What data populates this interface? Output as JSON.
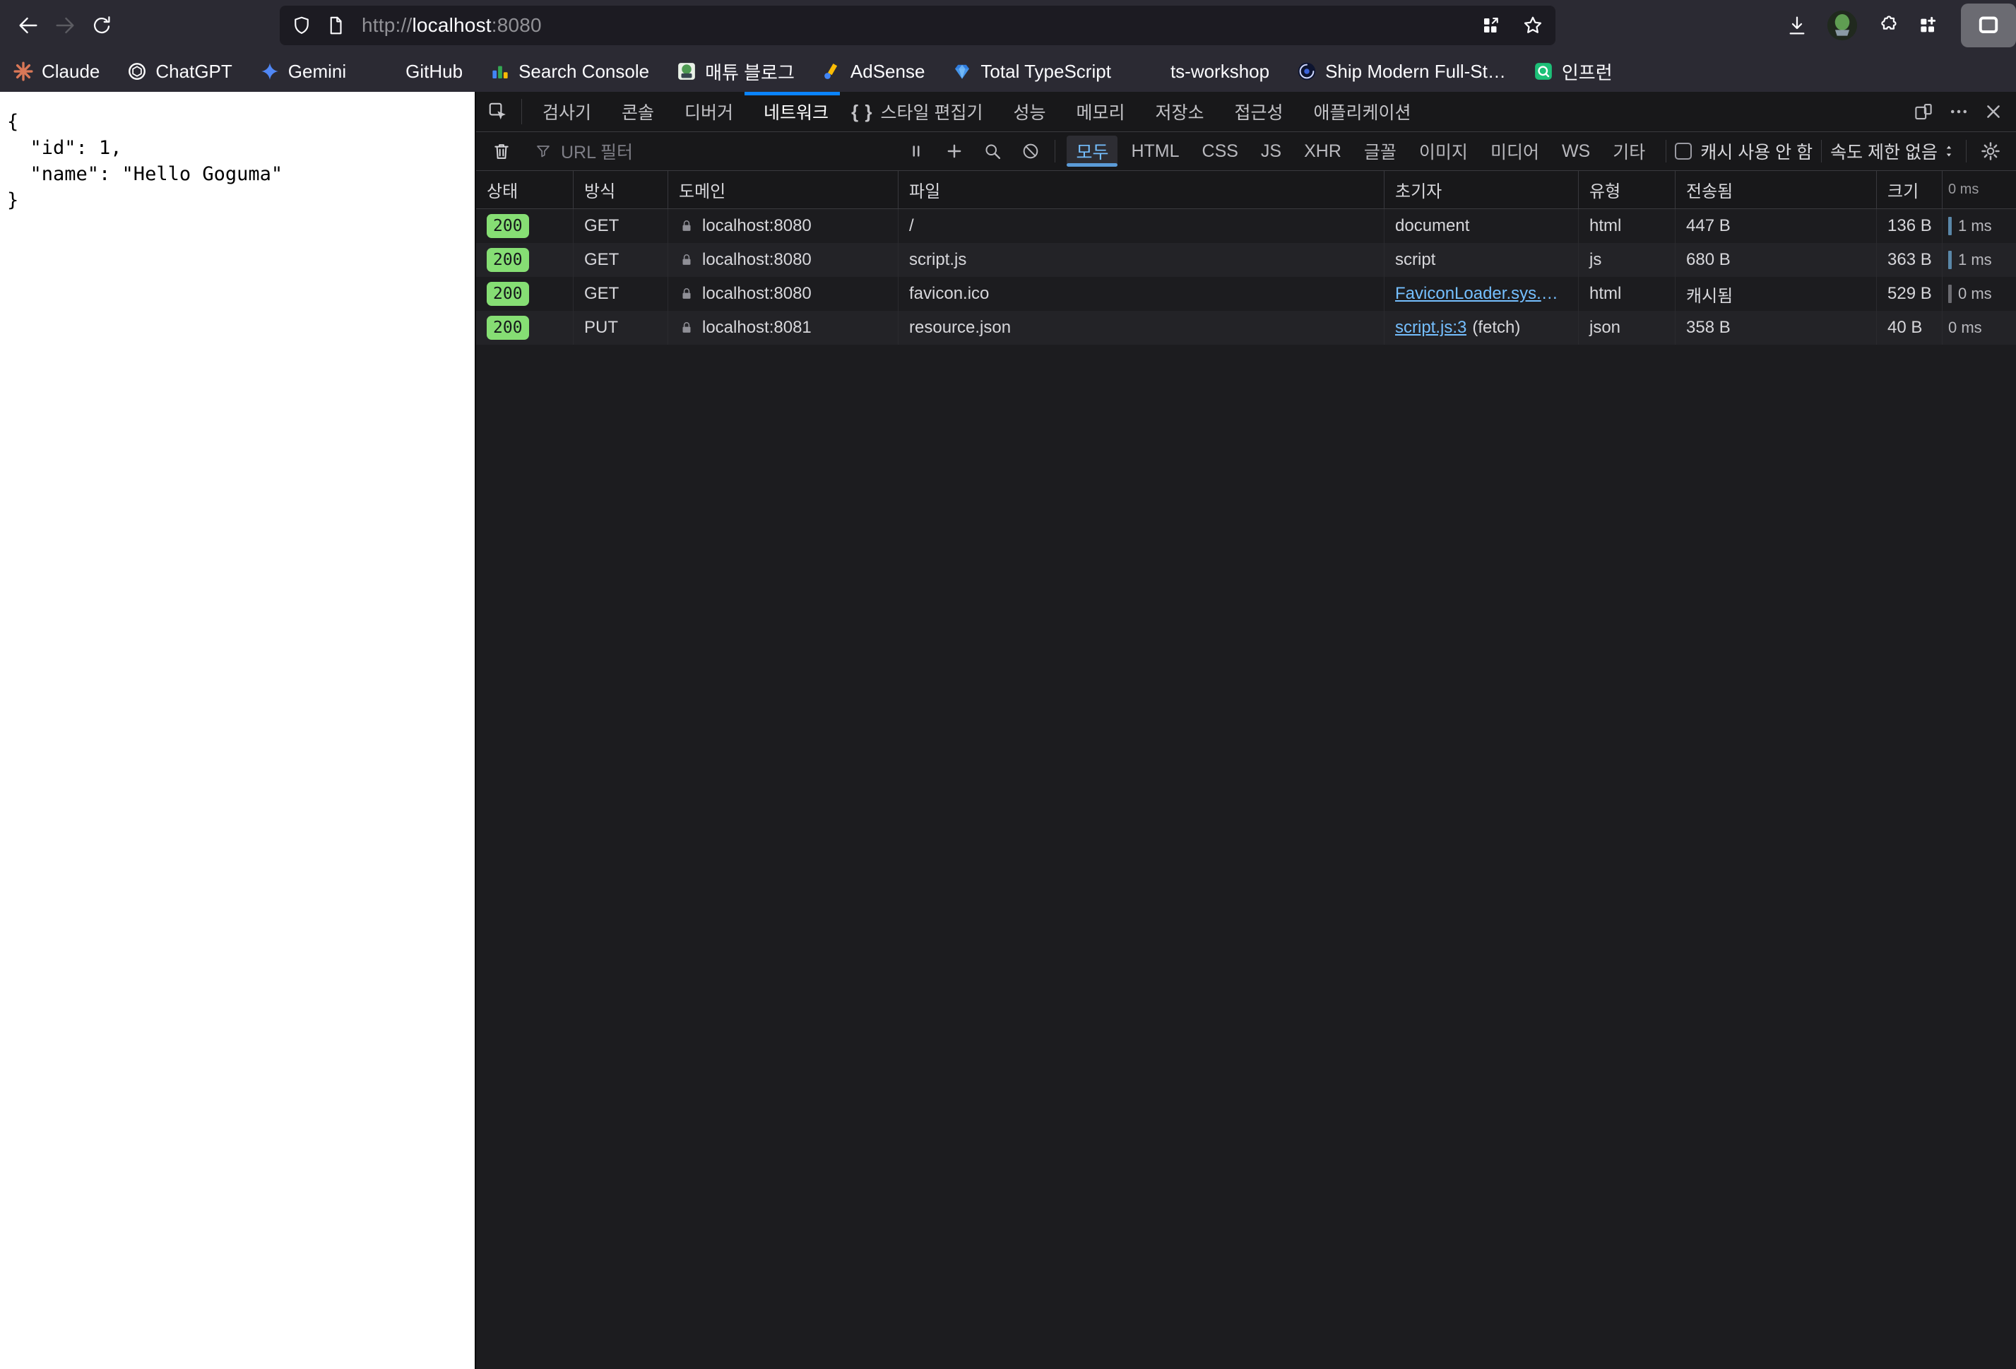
{
  "colors": {
    "accent_blue": "#0a84ff",
    "link_blue": "#75bfff",
    "status_green": "#86de74",
    "waterfall_blue": "#5a87a8",
    "waterfall_gray": "#6b6b70"
  },
  "browser": {
    "url": {
      "scheme": "http://",
      "host": "localhost",
      "port": ":8080"
    },
    "bookmarks": [
      {
        "label": "Claude",
        "icon": "claude-favicon"
      },
      {
        "label": "ChatGPT",
        "icon": "chatgpt-favicon"
      },
      {
        "label": "Gemini",
        "icon": "gemini-favicon"
      },
      {
        "label": "GitHub",
        "icon": null,
        "spacer_before": true
      },
      {
        "label": "Search Console",
        "icon": "search-console-favicon"
      },
      {
        "label": "매튜 블로그",
        "icon": "matthew-blog-favicon"
      },
      {
        "label": "AdSense",
        "icon": "adsense-favicon"
      },
      {
        "label": "Total TypeScript",
        "icon": "total-typescript-favicon"
      },
      {
        "label": "ts-workshop",
        "icon": null,
        "spacer_before": true
      },
      {
        "label": "Ship Modern Full-St…",
        "icon": "ship-favicon"
      },
      {
        "label": "인프런",
        "icon": "inflearn-favicon"
      }
    ]
  },
  "page": {
    "json_lines": [
      "{",
      "  \"id\": 1,",
      "  \"name\": \"Hello Goguma\"",
      "}"
    ]
  },
  "devtools": {
    "tabs": [
      {
        "label": "검사기",
        "icon": "inspector-icon",
        "active": false
      },
      {
        "label": "콘솔",
        "icon": "console-icon",
        "active": false
      },
      {
        "label": "디버거",
        "icon": "debugger-icon",
        "active": false
      },
      {
        "label": "네트워크",
        "icon": "network-icon",
        "active": true
      },
      {
        "label": "스타일 편집기",
        "icon": "style-editor-icon",
        "active": false
      },
      {
        "label": "성능",
        "icon": "performance-icon",
        "active": false
      },
      {
        "label": "메모리",
        "icon": "memory-icon",
        "active": false
      },
      {
        "label": "저장소",
        "icon": "storage-icon",
        "active": false
      },
      {
        "label": "접근성",
        "icon": "accessibility-icon",
        "active": false
      },
      {
        "label": "애플리케이션",
        "icon": "application-icon",
        "active": false
      }
    ],
    "network": {
      "url_filter_placeholder": "URL 필터",
      "filters": [
        "모두",
        "HTML",
        "CSS",
        "JS",
        "XHR",
        "글꼴",
        "이미지",
        "미디어",
        "WS",
        "기타"
      ],
      "active_filter": "모두",
      "cache_checkbox_label": "캐시 사용 안 함",
      "throttling_label": "속도 제한 없음",
      "columns": [
        "상태",
        "방식",
        "도메인",
        "파일",
        "초기자",
        "유형",
        "전송됨",
        "크기"
      ],
      "waterfall_scale_label": "0 ms",
      "requests": [
        {
          "status": "200",
          "method": "GET",
          "domain": "localhost:8080",
          "file": "/",
          "initiator": "document",
          "initiator_is_link": false,
          "initiator_suffix": "",
          "type": "html",
          "transferred": "447 B",
          "size": "136 B",
          "time": "1 ms",
          "bar": "blue"
        },
        {
          "status": "200",
          "method": "GET",
          "domain": "localhost:8080",
          "file": "script.js",
          "initiator": "script",
          "initiator_is_link": false,
          "initiator_suffix": "",
          "type": "js",
          "transferred": "680 B",
          "size": "363 B",
          "time": "1 ms",
          "bar": "blue"
        },
        {
          "status": "200",
          "method": "GET",
          "domain": "localhost:8080",
          "file": "favicon.ico",
          "initiator": "FaviconLoader.sys.mjs…",
          "initiator_is_link": true,
          "initiator_suffix": "",
          "type": "html",
          "transferred": "캐시됨",
          "size": "529 B",
          "time": "0 ms",
          "bar": "gray"
        },
        {
          "status": "200",
          "method": "PUT",
          "domain": "localhost:8081",
          "file": "resource.json",
          "initiator": "script.js:3",
          "initiator_is_link": true,
          "initiator_suffix": "(fetch)",
          "type": "json",
          "transferred": "358 B",
          "size": "40 B",
          "time": "0 ms",
          "bar": "none"
        }
      ]
    }
  }
}
